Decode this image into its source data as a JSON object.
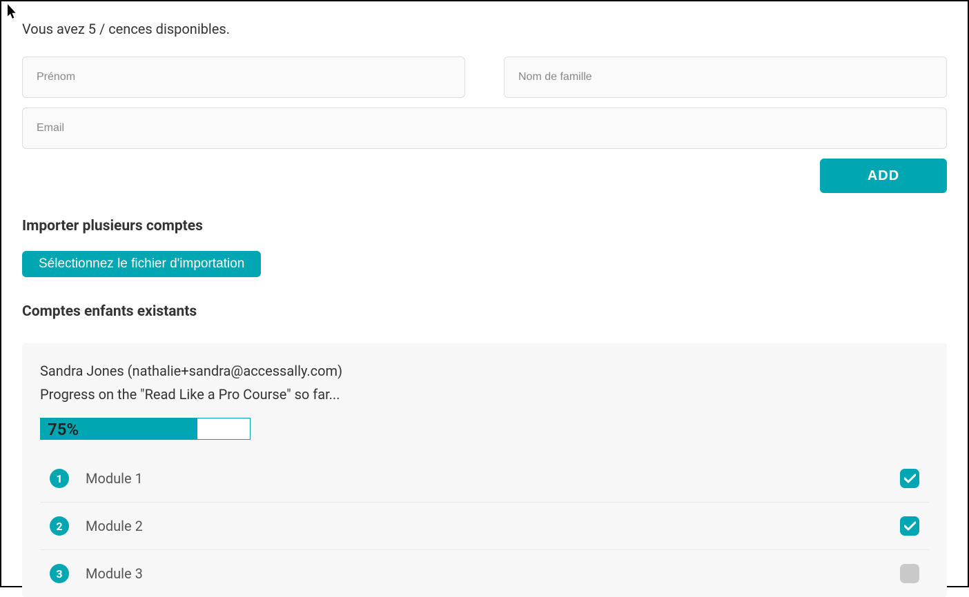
{
  "license_text": "Vous avez 5 / cences disponibles.",
  "form": {
    "first_name_placeholder": "Prénom",
    "last_name_placeholder": "Nom de famille",
    "email_placeholder": "Email",
    "add_button_label": "ADD"
  },
  "import": {
    "heading": "Importer plusieurs comptes",
    "button_label": "Sélectionnez le fichier d'importation"
  },
  "existing": {
    "heading": "Comptes enfants existants",
    "account": {
      "name_line": "Sandra Jones (nathalie+sandra@accessally.com)",
      "progress_line": "Progress on the \"Read Like a Pro Course\" so far...",
      "progress_percent_label": "75%",
      "progress_percent_value": 75,
      "modules": [
        {
          "num": "1",
          "label": "Module 1",
          "completed": true
        },
        {
          "num": "2",
          "label": "Module 2",
          "completed": true
        },
        {
          "num": "3",
          "label": "Module 3",
          "completed": false
        }
      ]
    }
  },
  "colors": {
    "accent": "#00a7b3",
    "inactive": "#c9c9c9"
  }
}
